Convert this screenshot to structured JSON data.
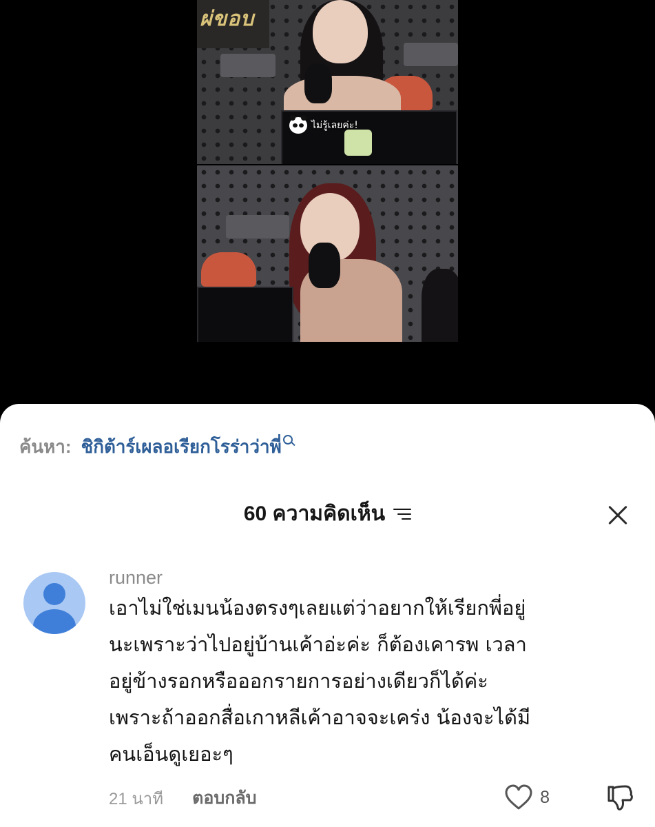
{
  "video": {
    "neon_sign_text": "ผ่ขอบ",
    "subtitle": "ไม่รู้เลยค่ะ!",
    "subtitle_icon": "panda-icon"
  },
  "search": {
    "prefix": "ค้นหา:",
    "query": "ชิกิต้าร์เผลอเรียกโรร่าว่าพี่",
    "icon": "search-icon"
  },
  "comments_header": {
    "title": "60 ความคิดเห็น",
    "sort_icon": "sort-icon",
    "close_icon": "close-icon"
  },
  "comment": {
    "username": "runner",
    "avatar_icon": "avatar-person-icon",
    "lines": [
      "เอาไม่ใช่เมนน้องตรงๆเลยแต่ว่าอยากให้เรียกพี่อยู่",
      "นะเพราะว่าไปอยู่บ้านเค้าอ่ะค่ะ ก็ต้องเคารพ เวลา",
      "อยู่ข้างรอกหรือออกรายการอย่างเดียวก็ได้ค่ะ",
      "เพราะถ้าออกสื่อเกาหลีเค้าอาจจะเคร่ง น้องจะได้มี",
      "คนเอ็นดูเยอะๆ"
    ],
    "timestamp": "21 นาที",
    "reply_label": "ตอบกลับ",
    "like_count": "8",
    "like_icon": "heart-outline-icon",
    "dislike_icon": "thumbs-down-icon"
  },
  "colors": {
    "search_query": "#2f5f98",
    "avatar_bg": "#a9c8f4",
    "avatar_fg": "#3f7fd9"
  }
}
